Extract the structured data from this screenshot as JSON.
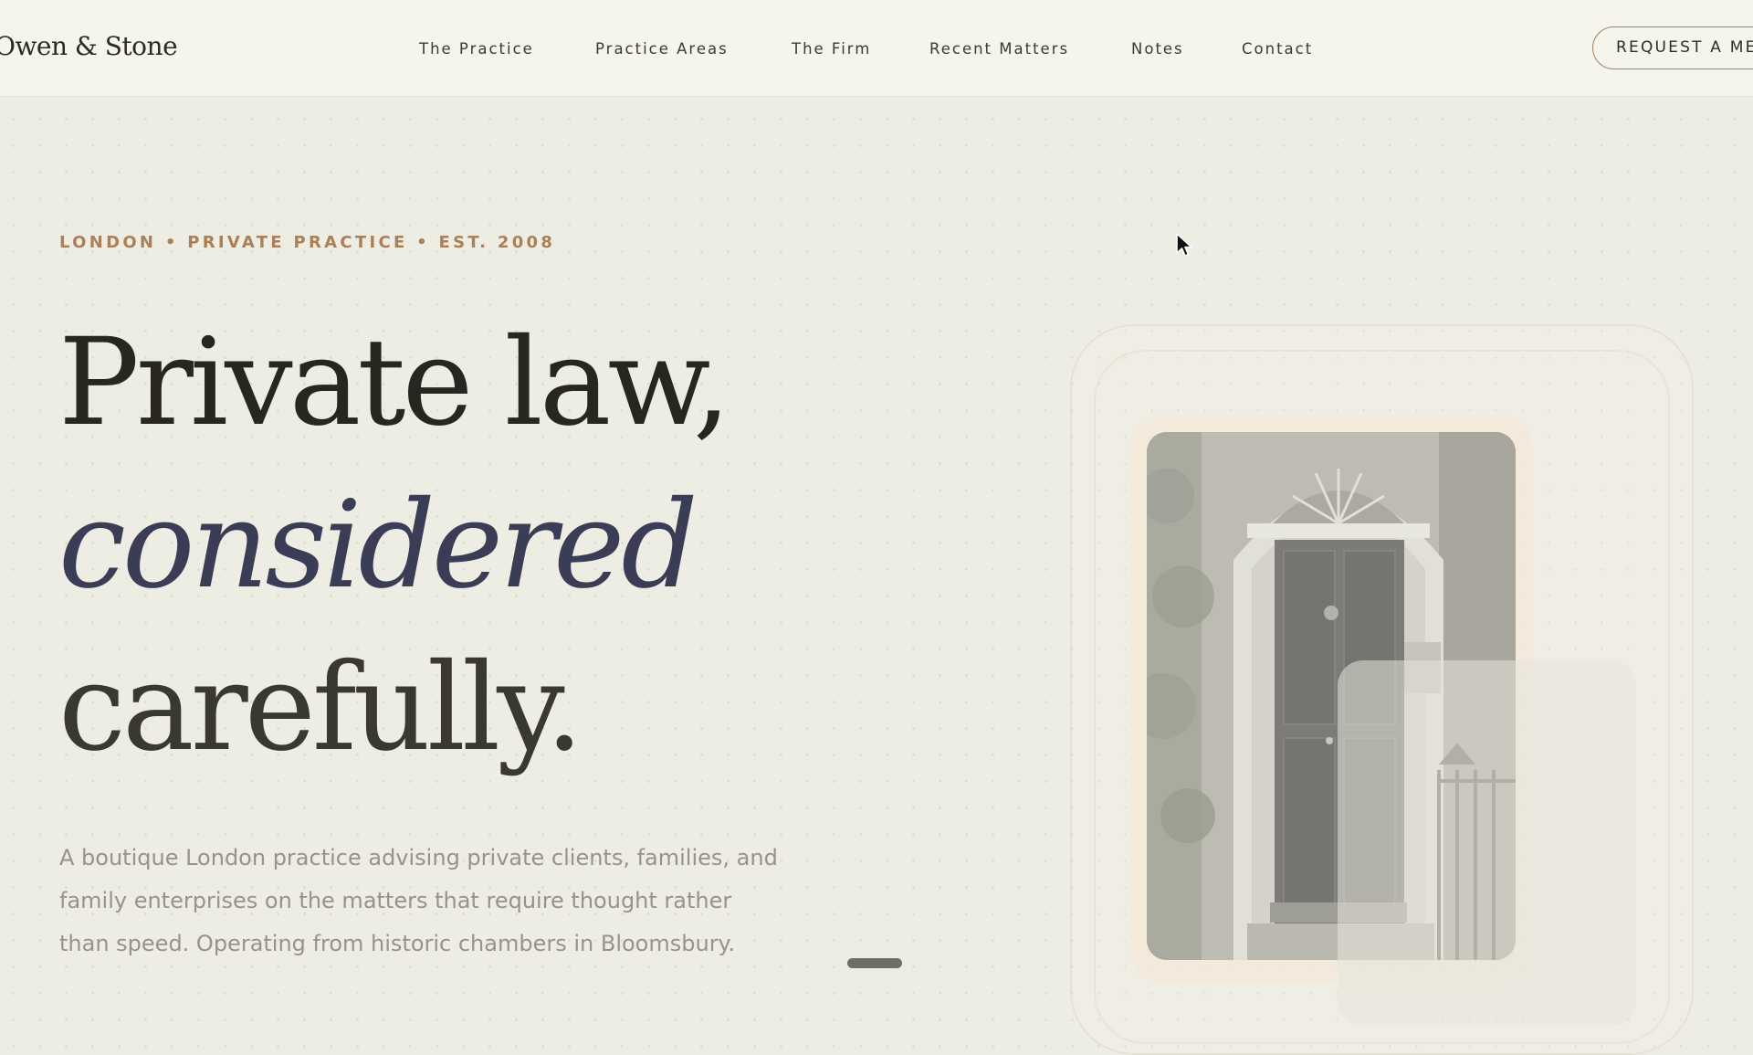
{
  "header": {
    "brand": "Owen & Stone",
    "nav": [
      {
        "label": "The Practice"
      },
      {
        "label": "Practice Areas"
      },
      {
        "label": "The Firm"
      },
      {
        "label": "Recent Matters"
      },
      {
        "label": "Notes"
      },
      {
        "label": "Contact"
      }
    ],
    "cta_label": "REQUEST A MEETING"
  },
  "hero": {
    "eyebrow": "LONDON • PRIVATE PRACTICE • EST. 2008",
    "headline": {
      "line1": "Private law,",
      "line2": "considered",
      "line3": "carefully."
    },
    "lede": "A boutique London practice advising private clients, families, and family enterprises on the matters that require thought rather than speed. Operating from historic chambers in Bloomsbury."
  },
  "colors": {
    "background": "#eeede4",
    "accent_gold": "#a8805a",
    "headline_ink": "#272620",
    "italic_ink": "#3a3d55",
    "body_text": "#95938a"
  },
  "icons": {
    "cursor": "mouse-pointer-icon",
    "scroll": "scroll-indicator"
  }
}
